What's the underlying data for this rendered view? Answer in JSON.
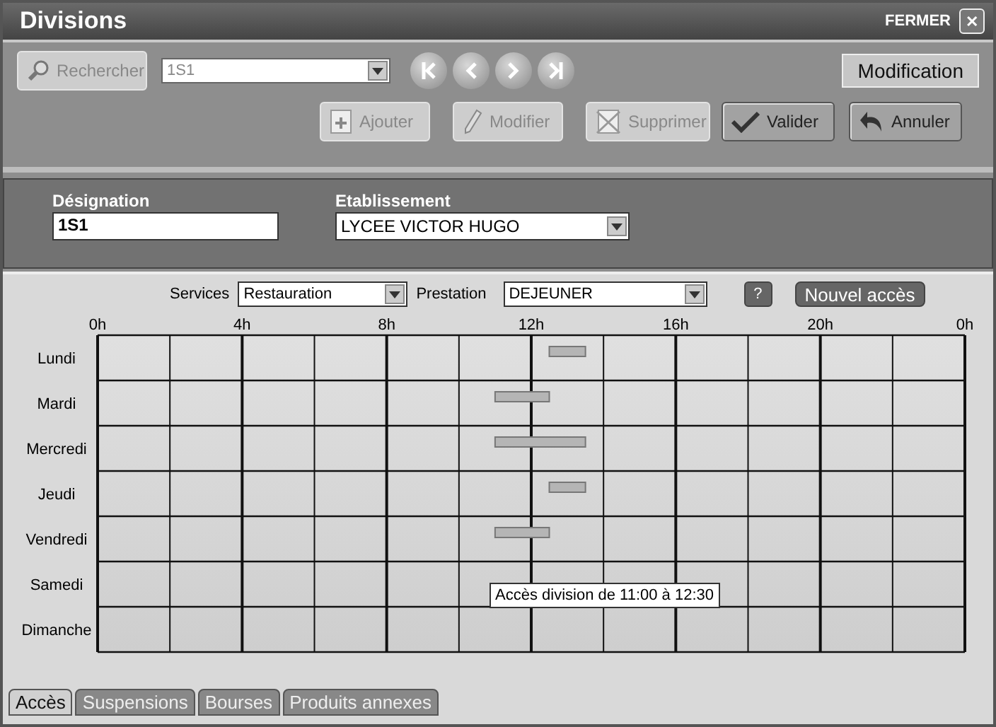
{
  "window": {
    "title": "Divisions",
    "close_label": "FERMER",
    "close_glyph": "✕"
  },
  "toolbar": {
    "search_button": {
      "label": "Rechercher",
      "disabled": true
    },
    "record_select": {
      "value": "1S1",
      "disabled": true
    },
    "nav": [
      {
        "kind": "first"
      },
      {
        "kind": "prev"
      },
      {
        "kind": "next"
      },
      {
        "kind": "last"
      }
    ],
    "mode": "Modification",
    "actions": [
      {
        "kind": "add",
        "label": "Ajouter",
        "disabled": true
      },
      {
        "kind": "edit",
        "label": "Modifier",
        "disabled": true
      },
      {
        "kind": "delete",
        "label": "Supprimer",
        "disabled": true
      },
      {
        "kind": "validate",
        "label": "Valider",
        "disabled": false
      },
      {
        "kind": "cancel",
        "label": "Annuler",
        "disabled": false
      }
    ]
  },
  "header": {
    "designation": {
      "label": "Désignation",
      "value": "1S1"
    },
    "etablissement": {
      "label": "Etablissement",
      "value": "LYCEE VICTOR HUGO"
    }
  },
  "filters": {
    "services": {
      "label": "Services",
      "value": "Restauration"
    },
    "prestation": {
      "label": "Prestation",
      "value": "DEJEUNER"
    },
    "help": "?",
    "new_button": "Nouvel accès"
  },
  "schedule": {
    "hours": [
      "0h",
      "4h",
      "8h",
      "12h",
      "16h",
      "20h",
      "0h"
    ],
    "days": [
      {
        "label": "Lundi",
        "accesses": [
          {
            "start": {
              "level": 0.5208
            },
            "end": {
              "level": 0.5625
            }
          }
        ]
      },
      {
        "label": "Mardi",
        "accesses": [
          {
            "start": {
              "level": 0.4583
            },
            "end": {
              "level": 0.5208
            }
          }
        ]
      },
      {
        "label": "Mercredi",
        "accesses": [
          {
            "start": {
              "level": 0.4583
            },
            "end": {
              "level": 0.5625
            }
          }
        ]
      },
      {
        "label": "Jeudi",
        "accesses": [
          {
            "start": {
              "level": 0.5208
            },
            "end": {
              "level": 0.5625
            }
          }
        ]
      },
      {
        "label": "Vendredi",
        "accesses": [
          {
            "start": {
              "level": 0.4583
            },
            "end": {
              "level": 0.5208
            }
          }
        ]
      },
      {
        "label": "Samedi"
      },
      {
        "label": "Dimanche"
      }
    ],
    "tooltip": "Accès division de 11:00 à 12:30"
  },
  "tabs": [
    {
      "label": "Accès",
      "selected": true
    },
    {
      "label": "Suspensions",
      "selected": false
    },
    {
      "label": "Bourses",
      "selected": false
    },
    {
      "label": "Produits annexes",
      "selected": false
    }
  ]
}
